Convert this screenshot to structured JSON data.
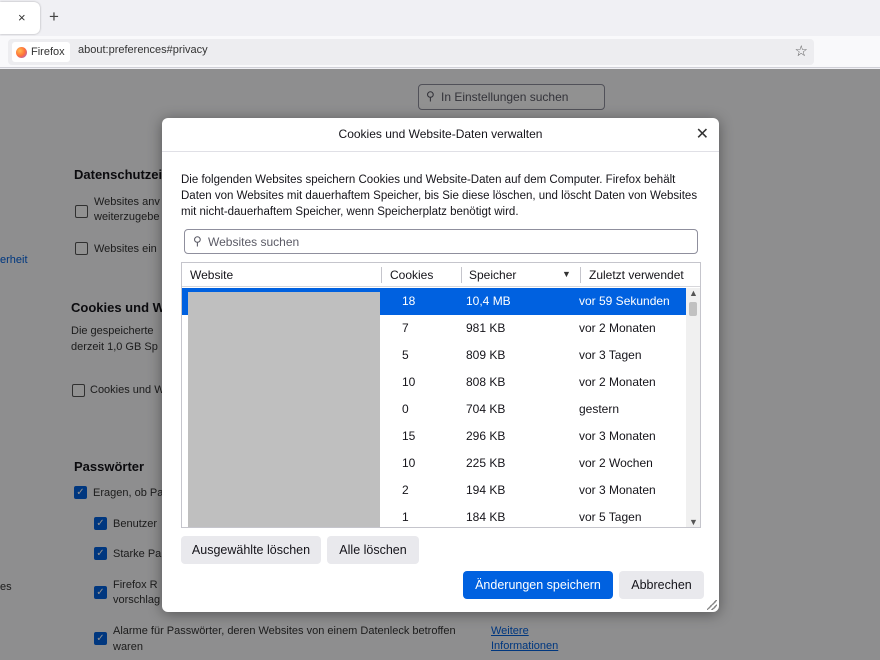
{
  "browser": {
    "tab_close": "×",
    "new_tab": "+",
    "identity_label": "Firefox",
    "url": "about:preferences#privacy",
    "bookmark_icon": "star-icon"
  },
  "page": {
    "search_placeholder": "In Einstellungen suchen",
    "privacy_heading": "Datenschutzei",
    "websites_line1": "Websites anv",
    "websites_line2": "weiterzugebe",
    "websites_line3": "Websites ein",
    "sidebar_fragment_1": "erheit",
    "sidebar_fragment_2": "es",
    "cookies_heading": "Cookies und W",
    "cookies_text1": "Die gespeicherte",
    "cookies_text2": "derzeit 1,0 GB Sp",
    "cookies_checkbox": "Cookies und W",
    "passwords_heading": "Passwörter",
    "ask_label": "Eragen, ob Pa",
    "username_label": "Benutzer",
    "strong_label": "Starke Pa",
    "firefox_line1": "Firefox R",
    "firefox_line2": "vorschlag",
    "alerts_line1": "Alarme für Passwörter, deren Websites von einem Datenleck betroffen",
    "alerts_line2": "waren",
    "more_info_line1": "Weitere",
    "more_info_line2": "Informationen"
  },
  "dialog": {
    "title": "Cookies und Website-Daten verwalten",
    "close": "✕",
    "description": "Die folgenden Websites speichern Cookies und Website-Daten auf dem Computer. Firefox behält Daten von Websites mit dauerhaftem Speicher, bis Sie diese löschen, und löscht Daten von Websites mit nicht-dauerhaftem Speicher, wenn Speicherplatz benötigt wird.",
    "search_placeholder": "Websites suchen",
    "columns": [
      "Website",
      "Cookies",
      "Speicher",
      "Zuletzt verwendet"
    ],
    "rows": [
      {
        "cookies": "18",
        "storage": "10,4 MB",
        "last_used": "vor 59 Sekunden",
        "selected": true
      },
      {
        "cookies": "7",
        "storage": "981 KB",
        "last_used": "vor 2 Monaten",
        "selected": false
      },
      {
        "cookies": "5",
        "storage": "809 KB",
        "last_used": "vor 3 Tagen",
        "selected": false
      },
      {
        "cookies": "10",
        "storage": "808 KB",
        "last_used": "vor 2 Monaten",
        "selected": false
      },
      {
        "cookies": "0",
        "storage": "704 KB",
        "last_used": "gestern",
        "selected": false
      },
      {
        "cookies": "15",
        "storage": "296 KB",
        "last_used": "vor 3 Monaten",
        "selected": false
      },
      {
        "cookies": "10",
        "storage": "225 KB",
        "last_used": "vor 2 Wochen",
        "selected": false
      },
      {
        "cookies": "2",
        "storage": "194 KB",
        "last_used": "vor 3 Monaten",
        "selected": false
      },
      {
        "cookies": "1",
        "storage": "184 KB",
        "last_used": "vor 5 Tagen",
        "selected": false
      }
    ],
    "remove_selected_label": "Ausgewählte löschen",
    "remove_all_label": "Alle löschen",
    "save_label": "Änderungen speichern",
    "cancel_label": "Abbrechen"
  },
  "colors": {
    "accent": "#0061e0",
    "overlay": "rgba(0,0,0,0.43)",
    "button_bg": "#e9e9ed"
  }
}
